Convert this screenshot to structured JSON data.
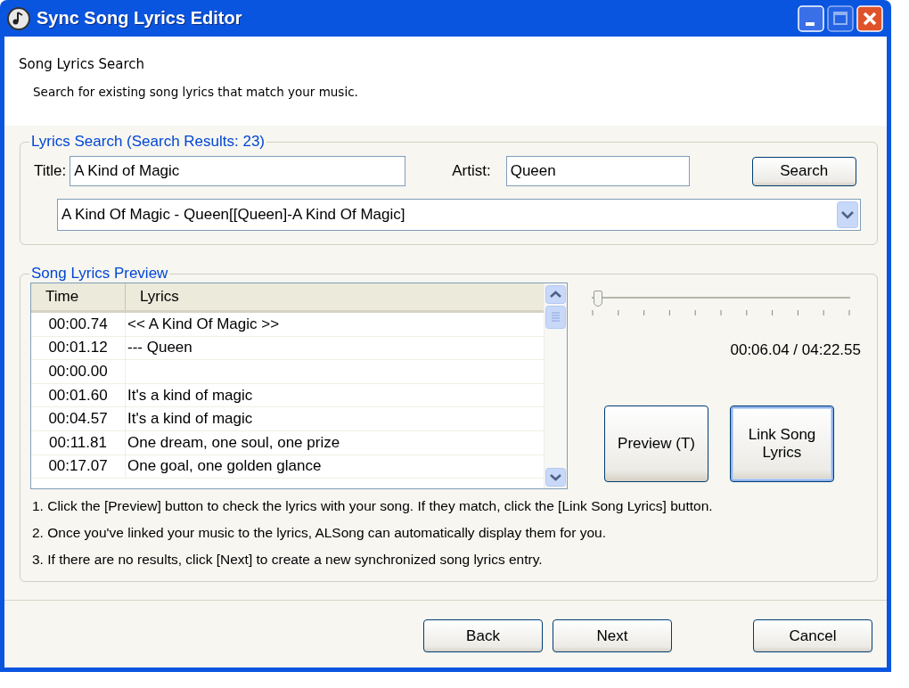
{
  "window": {
    "title": "Sync Song Lyrics Editor",
    "controls": [
      {
        "kind": "minimize",
        "disabled": false
      },
      {
        "kind": "maximize",
        "disabled": true
      },
      {
        "kind": "close",
        "disabled": false
      }
    ]
  },
  "header": {
    "title": "Song Lyrics Search",
    "description": "Search for existing song lyrics that match your music."
  },
  "search_group": {
    "legend": "Lyrics Search (Search Results: 23)",
    "title_label": "Title:",
    "title_value": "A Kind of Magic",
    "artist_label": "Artist:",
    "artist_value": "Queen",
    "search_button": "Search",
    "result": "A Kind Of Magic - Queen[[Queen]-A Kind Of Magic]"
  },
  "preview_group": {
    "legend": "Song Lyrics Preview",
    "table": {
      "columns": [
        "Time",
        "Lyrics"
      ],
      "rows": [
        {
          "time": "00:00.74",
          "lyrics": "<< A Kind Of Magic >>"
        },
        {
          "time": "00:01.12",
          "lyrics": "--- Queen"
        },
        {
          "time": "00:00.00"
        },
        {
          "time": "00:01.60",
          "lyrics": "It's a kind of magic"
        },
        {
          "time": "00:04.57",
          "lyrics": "It's a kind of magic"
        },
        {
          "time": "00:11.81",
          "lyrics": "One dream, one soul, one prize"
        },
        {
          "time": "00:17.07",
          "lyrics": "One goal, one golden glance"
        }
      ]
    },
    "slider": {
      "level": 0.023
    },
    "position": "00:06.04 / 04:22.55",
    "buttons": [
      {
        "label": "Preview (T)",
        "default": false
      },
      {
        "label": "Link Song Lyrics",
        "default": true
      }
    ],
    "instructions": [
      "1. Click the [Preview] button to check the lyrics with your song. If they match, click the [Link Song Lyrics] button.",
      "2. Once you've linked your music to the lyrics, ALSong can automatically display them for you.",
      "3. If there are no results, click [Next] to create a new synchronized song lyrics entry."
    ]
  },
  "footer_buttons": [
    {
      "label": "Back"
    },
    {
      "label": "Next"
    },
    {
      "label": "Cancel"
    }
  ]
}
